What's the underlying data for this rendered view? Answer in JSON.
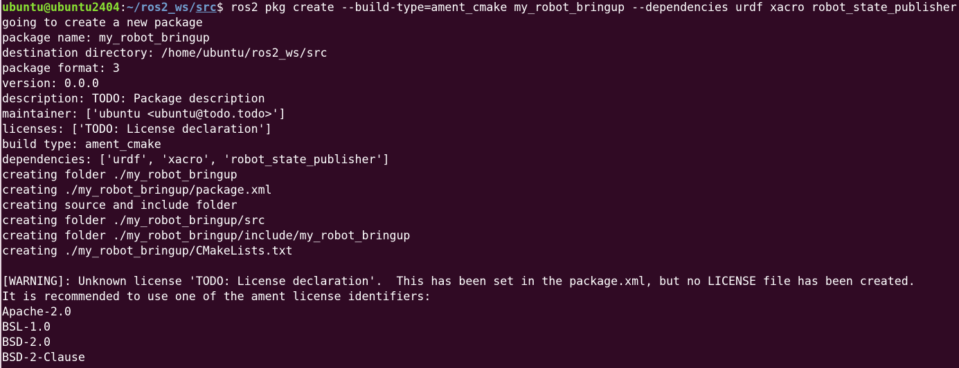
{
  "prompt": {
    "user_host": "ubuntu@ubuntu2404",
    "colon": ":",
    "path_home": "~/ros2_ws/",
    "path_src": "src",
    "dollar": "$ ",
    "command": "ros2 pkg create --build-type=ament_cmake my_robot_bringup --dependencies urdf xacro robot_state_publisher"
  },
  "output_lines": [
    "going to create a new package",
    "package name: my_robot_bringup",
    "destination directory: /home/ubuntu/ros2_ws/src",
    "package format: 3",
    "version: 0.0.0",
    "description: TODO: Package description",
    "maintainer: ['ubuntu <ubuntu@todo.todo>']",
    "licenses: ['TODO: License declaration']",
    "build type: ament_cmake",
    "dependencies: ['urdf', 'xacro', 'robot_state_publisher']",
    "creating folder ./my_robot_bringup",
    "creating ./my_robot_bringup/package.xml",
    "creating source and include folder",
    "creating folder ./my_robot_bringup/src",
    "creating folder ./my_robot_bringup/include/my_robot_bringup",
    "creating ./my_robot_bringup/CMakeLists.txt",
    "",
    "[WARNING]: Unknown license 'TODO: License declaration'.  This has been set in the package.xml, but no LICENSE file has been created.",
    "It is recommended to use one of the ament license identifiers:",
    "Apache-2.0",
    "BSL-1.0",
    "BSD-2.0",
    "BSD-2-Clause"
  ],
  "colors": {
    "background": "#300a24",
    "foreground": "#ffffff",
    "prompt_user": "#8ae234",
    "prompt_path": "#729fcf"
  }
}
